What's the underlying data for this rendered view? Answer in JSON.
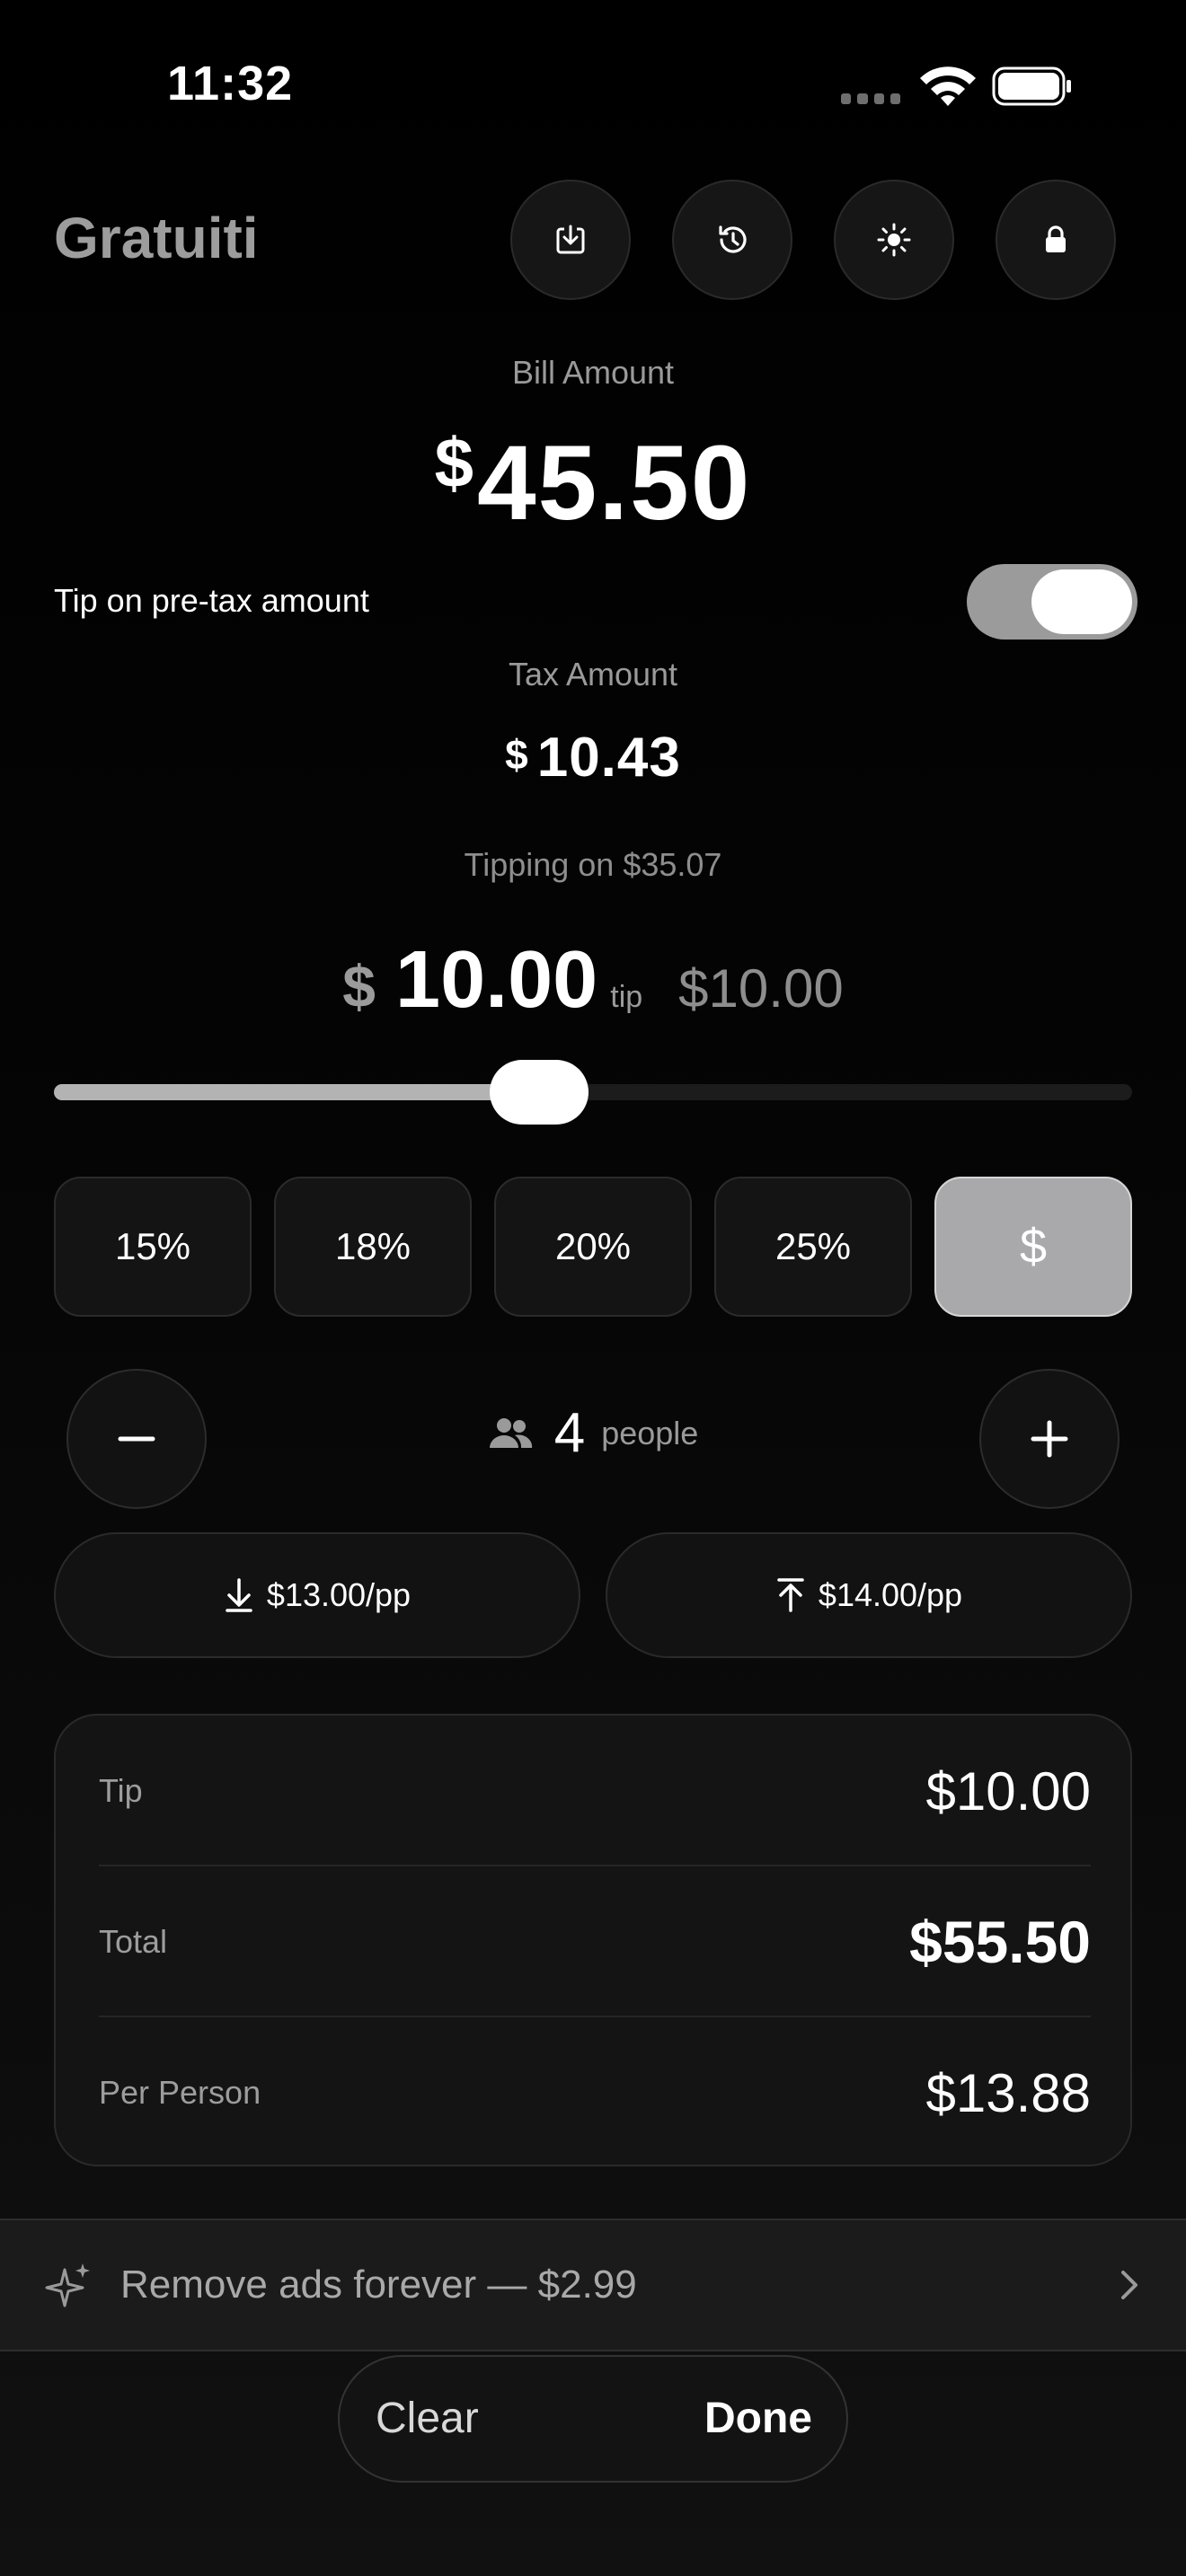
{
  "status_bar": {
    "time": "11:32"
  },
  "header": {
    "title": "Gratuiti",
    "buttons": [
      {
        "icon": "save-icon"
      },
      {
        "icon": "history-icon"
      },
      {
        "icon": "sun-icon"
      },
      {
        "icon": "lock-icon"
      }
    ]
  },
  "bill": {
    "label": "Bill Amount",
    "currency": "$",
    "amount": "45.50"
  },
  "pretax": {
    "label": "Tip on pre-tax amount",
    "enabled": true
  },
  "tax": {
    "label": "Tax Amount",
    "currency": "$",
    "amount": "10.43"
  },
  "tipping_on": "Tipping on $35.07",
  "tip": {
    "currency": "$",
    "amount": "10.00",
    "suffix": "tip",
    "alt_amount": "$10.00"
  },
  "slider": {
    "fraction": 0.45
  },
  "presets": [
    "15%",
    "18%",
    "20%",
    "25%",
    "$"
  ],
  "active_preset": "$",
  "people": {
    "count": "4",
    "label": "people"
  },
  "split": {
    "round_down": "$13.00/pp",
    "round_up": "$14.00/pp"
  },
  "summary": {
    "tip_label": "Tip",
    "tip_value": "$10.00",
    "total_label": "Total",
    "total_value": "$55.50",
    "per_person_label": "Per Person",
    "per_person_value": "$13.88"
  },
  "ad": {
    "text": "Remove ads forever — $2.99"
  },
  "actions": {
    "clear": "Clear",
    "done": "Done"
  },
  "colors": {
    "background": "#000000",
    "accent_toggle": "#9b9b9b",
    "active_preset": "#a9a9ac"
  }
}
